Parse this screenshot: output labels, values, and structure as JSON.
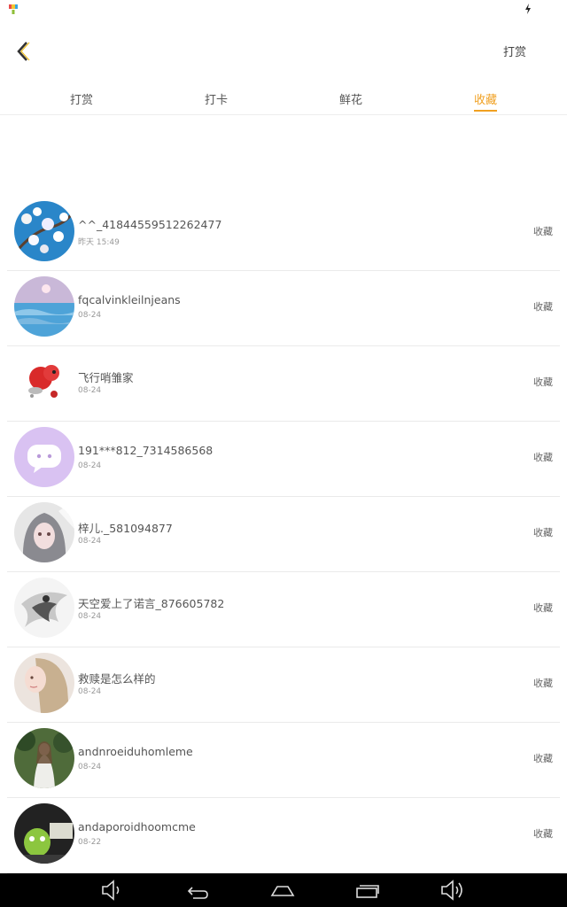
{
  "status_bar": {
    "app_icon": "gift-app-icon",
    "charging_icon": "charging-icon"
  },
  "header": {
    "back_icon": "chevron-left-icon",
    "action_label": "打赏"
  },
  "tabs": [
    {
      "label": "打赏",
      "active": false
    },
    {
      "label": "打卡",
      "active": false
    },
    {
      "label": "鲜花",
      "active": false
    },
    {
      "label": "收藏",
      "active": true
    }
  ],
  "accent_color": "#f0a021",
  "list": [
    {
      "name": "^^_41844559512262477",
      "time": "昨天 15:49",
      "action": "收藏",
      "avatar": "blossom-avatar"
    },
    {
      "name": "fqcalvinkleilnjeans",
      "time": "08-24",
      "action": "收藏",
      "avatar": "sea-avatar"
    },
    {
      "name": "飞行哨雏家",
      "time": "08-24",
      "action": "收藏",
      "avatar": "cartoon-avatar"
    },
    {
      "name": "191***812_7314586568",
      "time": "08-24",
      "action": "收藏",
      "avatar": "default-chat-avatar"
    },
    {
      "name": "梓儿._581094877",
      "time": "08-24",
      "action": "收藏",
      "avatar": "anime-girl-avatar"
    },
    {
      "name": "天空爱上了诺言_876605782",
      "time": "08-24",
      "action": "收藏",
      "avatar": "ink-painting-avatar"
    },
    {
      "name": "救赎是怎么样的",
      "time": "08-24",
      "action": "收藏",
      "avatar": "girl-portrait-avatar"
    },
    {
      "name": "andnroeiduhomleme",
      "time": "08-24",
      "action": "收藏",
      "avatar": "forest-avatar"
    },
    {
      "name": "andaporoidhoomcme",
      "time": "08-22",
      "action": "收藏",
      "avatar": "green-toy-avatar"
    }
  ],
  "nav_bar": {
    "buttons": [
      "volume-down-icon",
      "back-arrow-icon",
      "home-icon",
      "recent-apps-icon",
      "volume-up-icon"
    ]
  }
}
